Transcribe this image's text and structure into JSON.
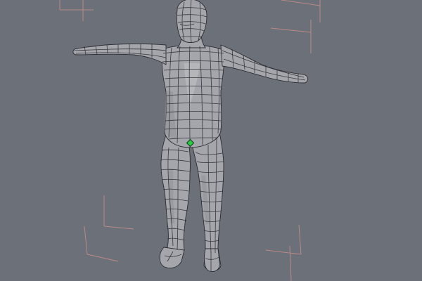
{
  "viewport": {
    "background": "#6c7079",
    "model": {
      "type": "human-base-mesh",
      "pose": "T-pose",
      "display": "shaded-wireframe",
      "skin_color": "#a4a6ab",
      "wire_color": "#2a2c33"
    },
    "pivot": {
      "color": "#2ecc40"
    },
    "bounding_box": {
      "color": "#b98a88"
    }
  }
}
